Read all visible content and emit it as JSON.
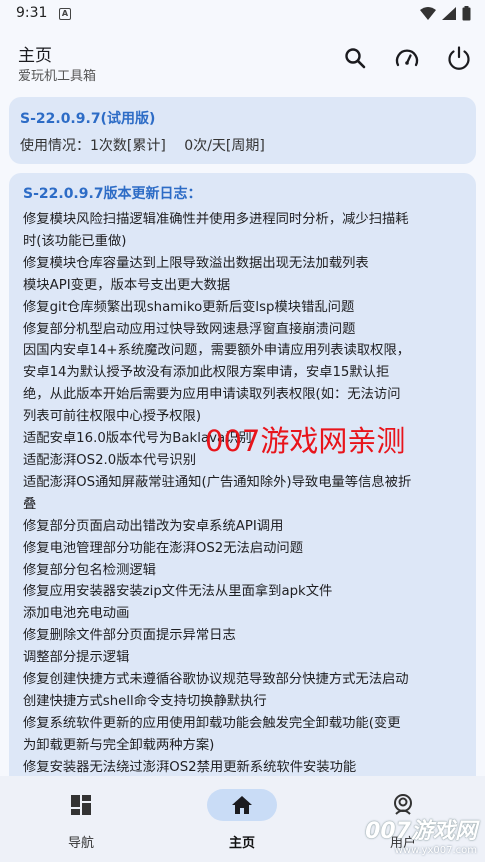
{
  "status": {
    "time": "9:31",
    "notification_icon": "a-icon"
  },
  "appbar": {
    "title": "主页",
    "subtitle": "爱玩机工具箱",
    "actions": [
      "search-icon",
      "speedometer-icon",
      "power-icon"
    ]
  },
  "license_card": {
    "version": "S-22.0.9.7(试用版)",
    "usage": "使用情况：1次数[累计]　 0次/天[周期]"
  },
  "changelog": {
    "title": "S-22.0.9.7版本更新日志：",
    "lines": [
      "修复模块风险扫描逻辑准确性并使用多进程同时分析，减少扫描耗",
      "时(该功能已重做)",
      "修复模块仓库容量达到上限导致溢出数据出现无法加载列表",
      "模块API变更，版本号支出更大数据",
      "修复git仓库频繁出现shamiko更新后变lsp模块错乱问题",
      "修复部分机型启动应用过快导致网速悬浮窗直接崩溃问题",
      "因国内安卓14+系统魔改问题，需要额外申请应用列表读取权限，",
      "安卓14为默认授予故没有添加此权限方案申请，安卓15默认拒",
      "绝，从此版本开始后需要为应用申请读取列表权限(如：无法访问",
      "列表可前往权限中心授予权限)",
      "适配安卓16.0版本代号为Baklava识别",
      "适配澎湃OS2.0版本代号识别",
      "适配澎湃OS通知屏蔽常驻通知(广告通知除外)导致电量等信息被折",
      "叠",
      "修复部分页面启动出错改为安卓系统API调用",
      "修复电池管理部分功能在澎湃OS2无法启动问题",
      "修复部分包名检测逻辑",
      "修复应用安装器安装zip文件无法从里面拿到apk文件",
      "添加电池充电动画",
      "修复删除文件部分页面提示异常日志",
      "调整部分提示逻辑",
      "修复创建快捷方式未遵循谷歌协议规范导致部分快捷方式无法启动",
      "创建快捷方式shell命令支持切换静默执行",
      "修复系统软件更新的应用使用卸载功能会触发完全卸载功能(变更",
      "为卸载更新与完全卸载两种方案)",
      "修复安装器无法绕过澎湃OS2禁用更新系统软件安装功能"
    ]
  },
  "watermark": {
    "text": "007游戏网亲测",
    "corner": "007游戏网",
    "url": "www.yx007.com"
  },
  "nav": {
    "items": [
      {
        "label": "导航",
        "icon": "dashboard-icon"
      },
      {
        "label": "主页",
        "icon": "home-icon",
        "active": true
      },
      {
        "label": "用户",
        "icon": "user-icon"
      }
    ]
  },
  "colors": {
    "accent": "#2d6cc6",
    "card": "#dde7f7",
    "nav_active": "#c9dcf6",
    "watermark": "#e8141b"
  }
}
